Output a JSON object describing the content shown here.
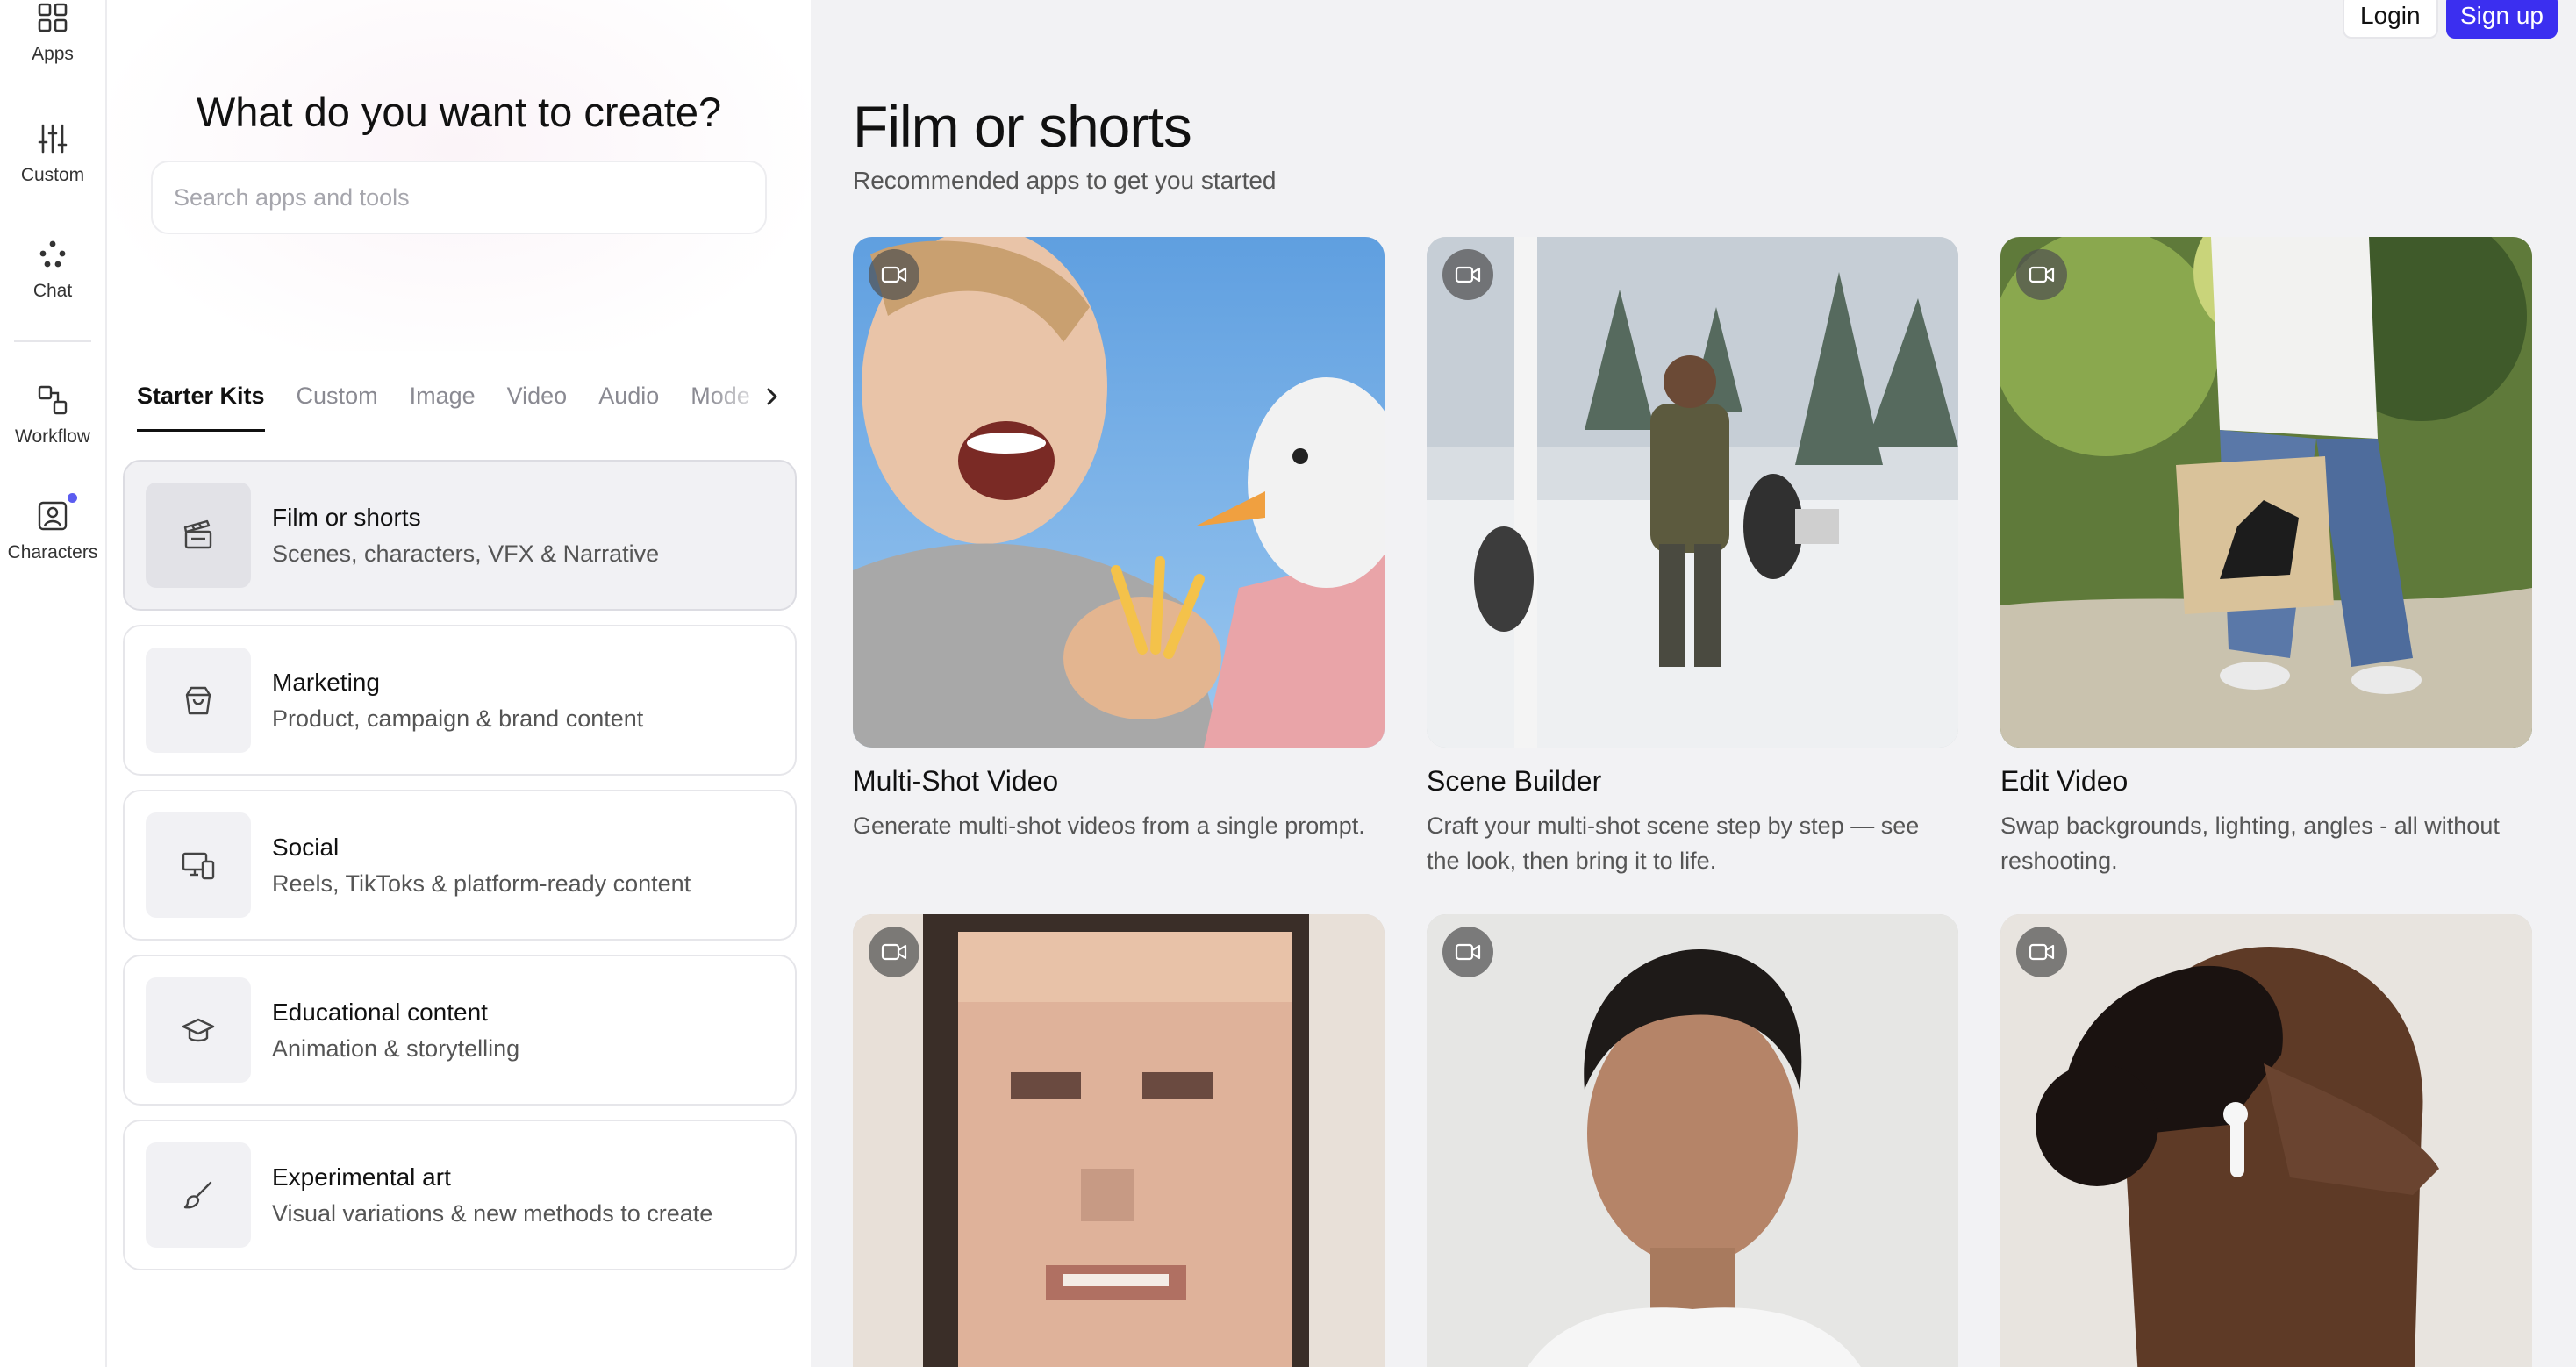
{
  "rail": {
    "items": [
      {
        "label": "Apps",
        "icon": "grid-icon"
      },
      {
        "label": "Custom",
        "icon": "sliders-icon"
      },
      {
        "label": "Chat",
        "icon": "chat-dots-icon"
      },
      {
        "label": "Workflow",
        "icon": "workflow-icon"
      },
      {
        "label": "Characters",
        "icon": "character-icon"
      }
    ]
  },
  "panel": {
    "title": "What do you want to create?",
    "search_placeholder": "Search apps and tools",
    "tabs": [
      {
        "label": "Starter Kits",
        "active": true
      },
      {
        "label": "Custom"
      },
      {
        "label": "Image"
      },
      {
        "label": "Video"
      },
      {
        "label": "Audio"
      },
      {
        "label": "Mode"
      }
    ],
    "kits": [
      {
        "title": "Film or shorts",
        "subtitle": "Scenes, characters, VFX & Narrative",
        "icon": "clapperboard-icon",
        "selected": true
      },
      {
        "title": "Marketing",
        "subtitle": "Product, campaign & brand content",
        "icon": "shopping-bag-icon"
      },
      {
        "title": "Social",
        "subtitle": "Reels, TikToks & platform-ready content",
        "icon": "devices-icon"
      },
      {
        "title": "Educational content",
        "subtitle": "Animation & storytelling",
        "icon": "graduation-cap-icon"
      },
      {
        "title": "Experimental art",
        "subtitle": "Visual variations & new methods to create",
        "icon": "brush-icon"
      }
    ]
  },
  "header": {
    "login": "Login",
    "signup": "Sign up",
    "accent": "#3b2ff0"
  },
  "main": {
    "title": "Film or shorts",
    "subtitle": "Recommended apps to get you started",
    "cards": [
      {
        "title": "Multi-Shot Video",
        "desc": "Generate multi-shot videos from a single prompt.",
        "image": "woman-seagull-fries"
      },
      {
        "title": "Scene Builder",
        "desc": "Craft your multi-shot scene step by step — see the look, then bring it to life.",
        "image": "snowy-forest-film-set"
      },
      {
        "title": "Edit Video",
        "desc": "Swap backgrounds, lighting, angles - all without reshooting.",
        "image": "person-walking-tote-bag"
      },
      {
        "title": "",
        "desc": "",
        "image": "pixelated-face"
      },
      {
        "title": "",
        "desc": "",
        "image": "man-portrait"
      },
      {
        "title": "",
        "desc": "",
        "image": "woman-profile-earbud"
      }
    ]
  }
}
